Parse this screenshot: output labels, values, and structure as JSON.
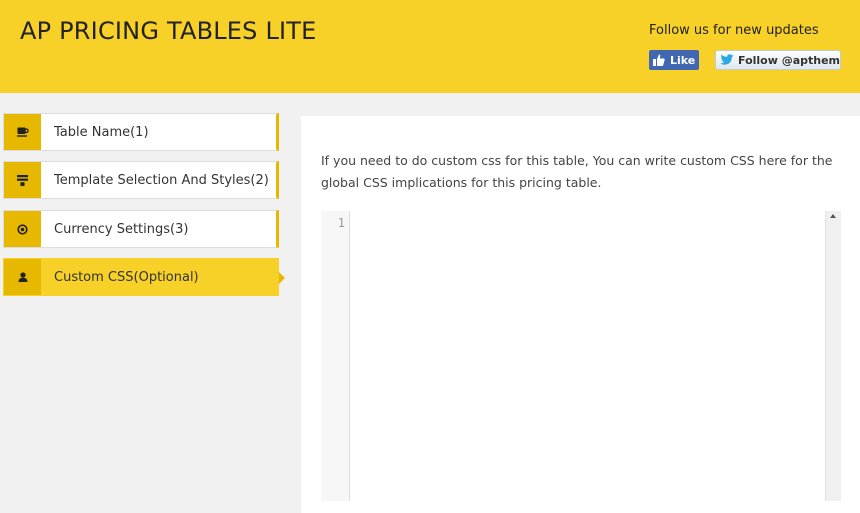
{
  "header": {
    "title": "AP PRICING TABLES LITE",
    "follow_text": "Follow us for new updates",
    "like_label": "Like",
    "twitter_label": "Follow @apthemes",
    "background_color": "#f7d028"
  },
  "sidebar": {
    "items": [
      {
        "label": "Table Name(1)",
        "icon": "cup-icon",
        "active": false
      },
      {
        "label": "Template Selection And Styles(2)",
        "icon": "template-icon",
        "active": false
      },
      {
        "label": "Currency Settings(3)",
        "icon": "currency-icon",
        "active": false
      },
      {
        "label": "Custom CSS(Optional)",
        "icon": "user-icon",
        "active": true
      }
    ],
    "accent_color": "#e6b800"
  },
  "main": {
    "description": "If you need to do custom css for this table, You can write custom CSS here for the global CSS implications for this pricing table.",
    "editor": {
      "line_number": "1",
      "value": ""
    }
  }
}
